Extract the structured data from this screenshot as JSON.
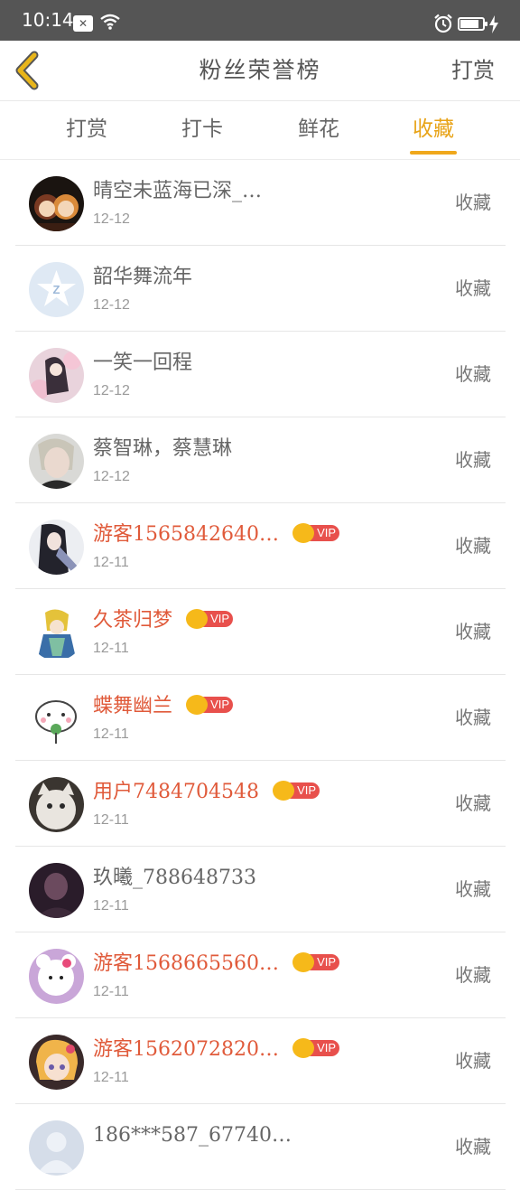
{
  "status_bar": {
    "time": "10:14",
    "icons": [
      "notification-icon",
      "wifi-icon",
      "alarm-icon",
      "battery-icon",
      "charging-icon"
    ],
    "battery_level": 0.85
  },
  "header": {
    "title": "粉丝荣誉榜",
    "action_label": "打赏",
    "back_icon": "chevron-left-icon"
  },
  "tabs": [
    {
      "label": "打赏",
      "active": false
    },
    {
      "label": "打卡",
      "active": false
    },
    {
      "label": "鲜花",
      "active": false
    },
    {
      "label": "收藏",
      "active": true
    }
  ],
  "colors": {
    "accent": "#f0a81c",
    "vip_name": "#e05a3a",
    "vip_badge": "#e8504c",
    "vip_crown": "#f6b91a",
    "status_bar": "#555555",
    "back_icon": "#e8a317"
  },
  "vip_label": "VIP",
  "list": [
    {
      "name": "晴空未蓝海已深_…",
      "date": "12-12",
      "action": "收藏",
      "vip": false,
      "avatar": "avatar-cartoon-pair"
    },
    {
      "name": "韶华舞流年",
      "date": "12-12",
      "action": "收藏",
      "vip": false,
      "avatar": "avatar-default-qq"
    },
    {
      "name": "一笑一回程",
      "date": "12-12",
      "action": "收藏",
      "vip": false,
      "avatar": "avatar-anime-girl"
    },
    {
      "name": "蔡智琳，蔡慧琳",
      "date": "12-12",
      "action": "收藏",
      "vip": false,
      "avatar": "avatar-portrait"
    },
    {
      "name": "游客1565842640…",
      "date": "12-11",
      "action": "收藏",
      "vip": true,
      "avatar": "avatar-ink-figure"
    },
    {
      "name": "久茶归梦",
      "date": "12-11",
      "action": "收藏",
      "vip": true,
      "avatar": "avatar-chibi"
    },
    {
      "name": "蝶舞幽兰",
      "date": "12-11",
      "action": "收藏",
      "vip": true,
      "avatar": "avatar-cat-cartoon"
    },
    {
      "name": "用户7484704548",
      "date": "12-11",
      "action": "收藏",
      "vip": true,
      "avatar": "avatar-cat-photo"
    },
    {
      "name": "玖曦_788648733",
      "date": "12-11",
      "action": "收藏",
      "vip": false,
      "avatar": "avatar-dark-portrait"
    },
    {
      "name": "游客1568665560…",
      "date": "12-11",
      "action": "收藏",
      "vip": true,
      "avatar": "avatar-plush"
    },
    {
      "name": "游客1562072820…",
      "date": "12-11",
      "action": "收藏",
      "vip": true,
      "avatar": "avatar-anime-blonde"
    },
    {
      "name": "186***587_67740…",
      "date": "",
      "action": "收藏",
      "vip": false,
      "avatar": "avatar-default"
    }
  ]
}
